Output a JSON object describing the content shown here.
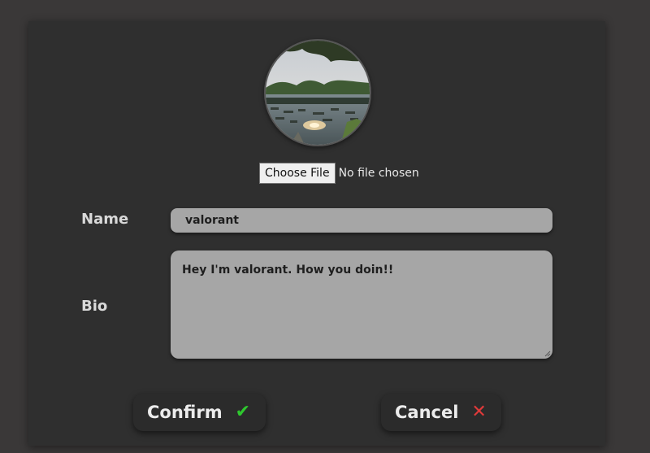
{
  "profile": {
    "avatar_icon": "landscape-photo",
    "file_button_label": "Choose File",
    "file_status": "No file chosen"
  },
  "form": {
    "name_label": "Name",
    "name_value": "valorant",
    "bio_label": "Bio",
    "bio_value": "Hey I'm valorant. How you doin!!"
  },
  "actions": {
    "confirm_label": "Confirm",
    "confirm_icon": "✔",
    "cancel_label": "Cancel",
    "cancel_icon": "✕"
  },
  "colors": {
    "page_bg": "#3a3838",
    "card_bg": "#2f2f2f",
    "field_bg": "#a6a6a6",
    "confirm_accent": "#2ec82e",
    "cancel_accent": "#e03a3a"
  }
}
